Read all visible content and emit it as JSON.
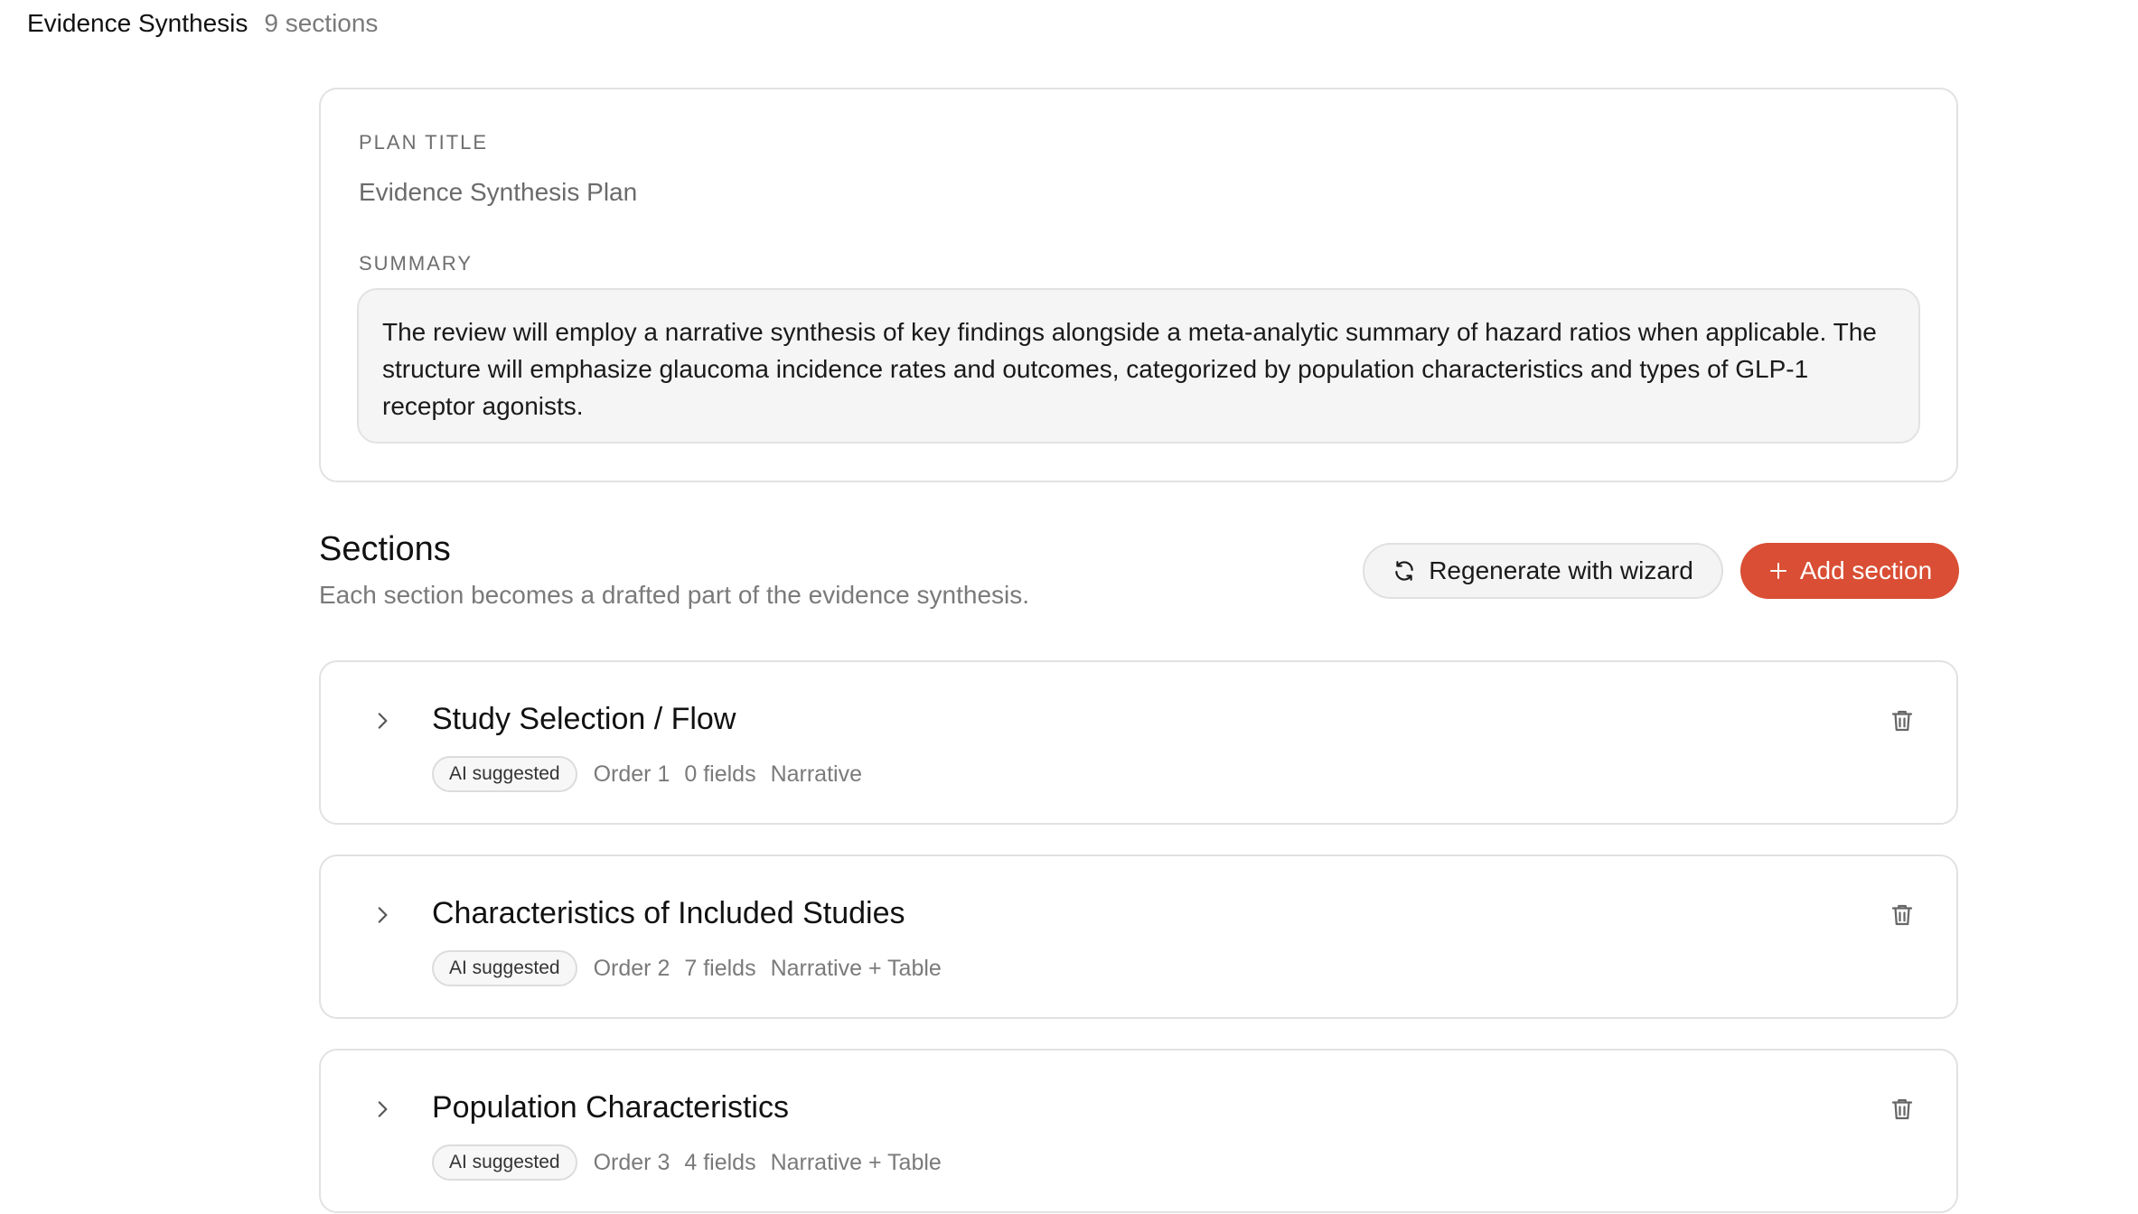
{
  "header": {
    "title": "Evidence Synthesis",
    "section_count": "9 sections"
  },
  "plan": {
    "title_label": "PLAN TITLE",
    "title_value": "Evidence Synthesis Plan",
    "summary_label": "SUMMARY",
    "summary_text": "The review will employ a narrative synthesis of key findings alongside a meta-analytic summary of hazard ratios when applicable. The structure will emphasize glaucoma incidence rates and outcomes, categorized by population characteristics and types of GLP-1 receptor agonists."
  },
  "sections": {
    "heading": "Sections",
    "subheading": "Each section becomes a drafted part of the evidence synthesis.",
    "regenerate_label": "Regenerate with wizard",
    "add_label": "Add section",
    "items": [
      {
        "title": "Study Selection / Flow",
        "badge": "AI suggested",
        "order": "Order 1",
        "fields": "0 fields",
        "type": "Narrative"
      },
      {
        "title": "Characteristics of Included Studies",
        "badge": "AI suggested",
        "order": "Order 2",
        "fields": "7 fields",
        "type": "Narrative + Table"
      },
      {
        "title": "Population Characteristics",
        "badge": "AI suggested",
        "order": "Order 3",
        "fields": "4 fields",
        "type": "Narrative + Table"
      }
    ]
  },
  "icons": {
    "regenerate": "refresh-icon",
    "add": "plus-icon",
    "expand": "chevron-right-icon",
    "delete": "trash-icon"
  },
  "colors": {
    "accent": "#d94e34"
  }
}
